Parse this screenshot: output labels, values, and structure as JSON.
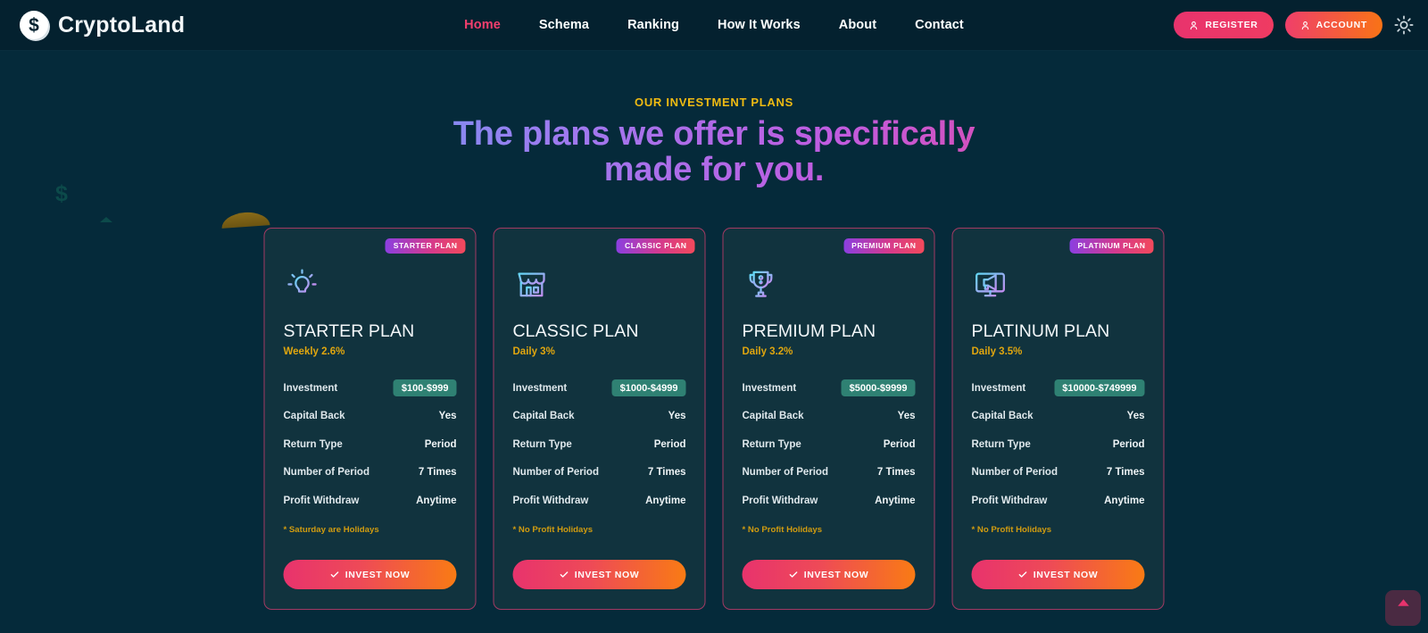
{
  "brand": {
    "name": "CryptoLand",
    "coin_symbol": "$",
    "logo_icon": "dollar-coin-icon"
  },
  "nav": {
    "items": [
      {
        "label": "Home",
        "active": true
      },
      {
        "label": "Schema",
        "active": false
      },
      {
        "label": "Ranking",
        "active": false
      },
      {
        "label": "How It Works",
        "active": false
      },
      {
        "label": "About",
        "active": false
      },
      {
        "label": "Contact",
        "active": false
      }
    ]
  },
  "header_actions": {
    "register_label": "REGISTER",
    "account_label": "ACCOUNT",
    "register_icon": "user-icon",
    "account_icon": "user-icon",
    "theme_icon": "sun-icon"
  },
  "section": {
    "eyebrow": "OUR INVESTMENT PLANS",
    "headline_line1": "The plans we offer is specifically",
    "headline_line2": "made for you."
  },
  "colors": {
    "page_bg": "#052a3a",
    "header_bg": "#04212f",
    "card_bg": "#11333e",
    "card_border": "#a33a63",
    "accent_pink": "#f43f6e",
    "accent_orange": "#f97316",
    "accent_gold": "#f0bb12",
    "pill_teal": "#2f8173"
  },
  "row_labels": [
    "Investment",
    "Capital Back",
    "Return Type",
    "Number of Period",
    "Profit Withdraw"
  ],
  "cards": [
    {
      "badge": "STARTER PLAN",
      "icon": "lightbulb-icon",
      "title": "STARTER PLAN",
      "rate": "Weekly 2.6%",
      "investment": "$100-$999",
      "capital_back": "Yes",
      "return_type": "Period",
      "number_of_period": "7 Times",
      "profit_withdraw": "Anytime",
      "note": "* Saturday are Holidays",
      "cta": "INVEST NOW"
    },
    {
      "badge": "CLASSIC PLAN",
      "icon": "storefront-icon",
      "title": "CLASSIC PLAN",
      "rate": "Daily 3%",
      "investment": "$1000-$4999",
      "capital_back": "Yes",
      "return_type": "Period",
      "number_of_period": "7 Times",
      "profit_withdraw": "Anytime",
      "note": "* No Profit Holidays",
      "cta": "INVEST NOW"
    },
    {
      "badge": "PREMIUM PLAN",
      "icon": "trophy-icon",
      "title": "PREMIUM PLAN",
      "rate": "Daily 3.2%",
      "investment": "$5000-$9999",
      "capital_back": "Yes",
      "return_type": "Period",
      "number_of_period": "7 Times",
      "profit_withdraw": "Anytime",
      "note": "* No Profit Holidays",
      "cta": "INVEST NOW"
    },
    {
      "badge": "PLATINUM PLAN",
      "icon": "monitor-megaphone-icon",
      "title": "PLATINUM PLAN",
      "rate": "Daily 3.5%",
      "investment": "$10000-$749999",
      "capital_back": "Yes",
      "return_type": "Period",
      "number_of_period": "7 Times",
      "profit_withdraw": "Anytime",
      "note": "* No Profit Holidays",
      "cta": "INVEST NOW"
    }
  ],
  "scroll_top": {
    "icon": "chevron-up-icon"
  }
}
